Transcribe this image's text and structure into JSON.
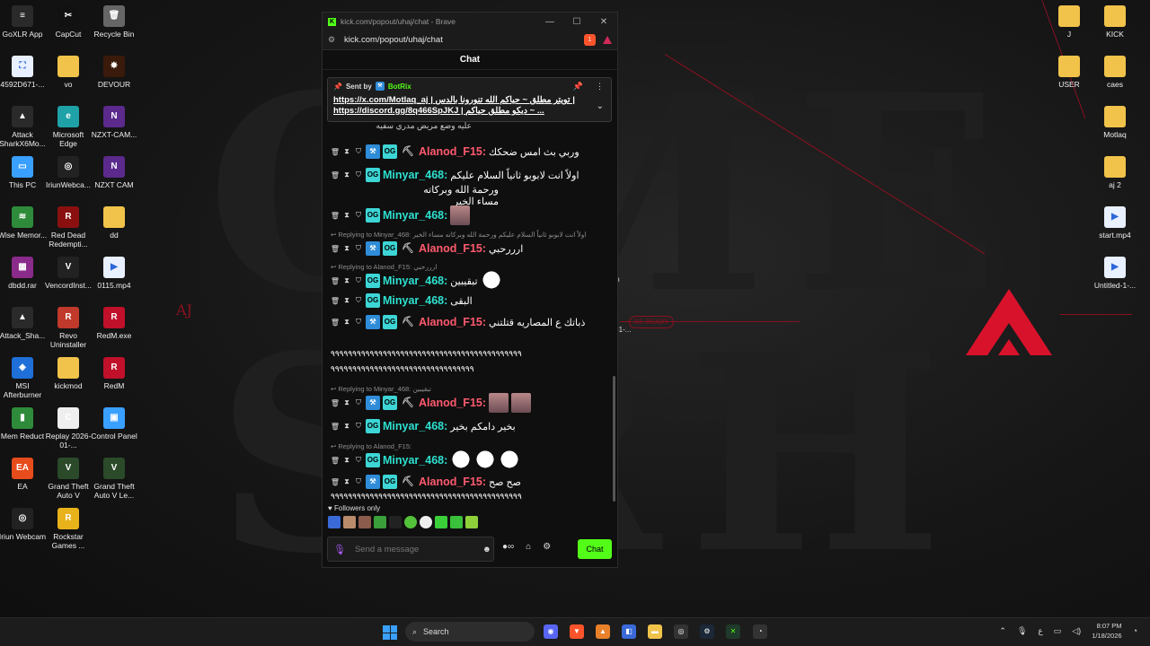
{
  "desktop": {
    "left_icons": [
      {
        "label": "GoXLR App",
        "color": "#2a2a2a",
        "glyph": "≡"
      },
      {
        "label": "CapCut",
        "color": "#111111",
        "glyph": "✂"
      },
      {
        "label": "Recycle Bin",
        "color": "#666666",
        "glyph": "🗑"
      },
      {
        "label": "4592D671-...",
        "color": "#e9f0ff",
        "glyph": "⛶"
      },
      {
        "label": "vo",
        "color": "#f1c34a",
        "glyph": ""
      },
      {
        "label": "DEVOUR",
        "color": "#3a1a0a",
        "glyph": "✸"
      },
      {
        "label": "Attack SharkX6Mo...",
        "color": "#2a2a2a",
        "glyph": "▲"
      },
      {
        "label": "Microsoft Edge",
        "color": "#1fa1a8",
        "glyph": "e"
      },
      {
        "label": "NZXT-CAM...",
        "color": "#5b2a8c",
        "glyph": "N"
      },
      {
        "label": "This PC",
        "color": "#3aa0ff",
        "glyph": "▭"
      },
      {
        "label": "IriunWebca...",
        "color": "#222222",
        "glyph": "◎"
      },
      {
        "label": "NZXT CAM",
        "color": "#5b2a8c",
        "glyph": "N"
      },
      {
        "label": "Wise Memor...",
        "color": "#2e8b3a",
        "glyph": "≋"
      },
      {
        "label": "Red Dead Redempti...",
        "color": "#8a1010",
        "glyph": "R"
      },
      {
        "label": "dd",
        "color": "#f1c34a",
        "glyph": ""
      },
      {
        "label": "dbdd.rar",
        "color": "#8a2a8a",
        "glyph": "▦"
      },
      {
        "label": "VencordInst...",
        "color": "#222222",
        "glyph": "V"
      },
      {
        "label": "0115.mp4",
        "color": "#e9f0ff",
        "glyph": "▶"
      },
      {
        "label": "Attack_Sha...",
        "color": "#2a2a2a",
        "glyph": "▲"
      },
      {
        "label": "Revo Uninstaller",
        "color": "#c0392b",
        "glyph": "R"
      },
      {
        "label": "RedM.exe",
        "color": "#c0102a",
        "glyph": "R"
      },
      {
        "label": "MSI Afterburner",
        "color": "#1f6fd8",
        "glyph": "◈"
      },
      {
        "label": "kickmod",
        "color": "#f1c34a",
        "glyph": ""
      },
      {
        "label": "RedM",
        "color": "#c0102a",
        "glyph": "R"
      },
      {
        "label": "Mem Reduct",
        "color": "#2e8b3a",
        "glyph": "▮"
      },
      {
        "label": "Replay 2026-01-...",
        "color": "#eeeeee",
        "glyph": "C"
      },
      {
        "label": "Control Panel",
        "color": "#3aa0ff",
        "glyph": "▣"
      },
      {
        "label": "EA",
        "color": "#e74c1c",
        "glyph": "EA"
      },
      {
        "label": "Grand Theft Auto V",
        "color": "#2a4a2a",
        "glyph": "V"
      },
      {
        "label": "Grand Theft Auto V Le...",
        "color": "#2a4a2a",
        "glyph": "V"
      },
      {
        "label": "Iriun Webcam",
        "color": "#222222",
        "glyph": "◎"
      },
      {
        "label": "Rockstar Games ...",
        "color": "#e8b21b",
        "glyph": "R"
      }
    ],
    "right_icons": [
      {
        "label": "J",
        "color": "#f1c34a",
        "glyph": ""
      },
      {
        "label": "KICK",
        "color": "#f1c34a",
        "glyph": ""
      },
      {
        "label": "USER",
        "color": "#f1c34a",
        "glyph": ""
      },
      {
        "label": "caes",
        "color": "#f1c34a",
        "glyph": ""
      },
      {
        "label": "Motlaq",
        "color": "#f1c34a",
        "glyph": ""
      },
      {
        "label": "aj 2",
        "color": "#f1c34a",
        "glyph": ""
      },
      {
        "label": "start.mp4",
        "color": "#e9f0ff",
        "glyph": "▶"
      },
      {
        "label": "Untitled-1-...",
        "color": "#e9f0ff",
        "glyph": "▶"
      }
    ],
    "partial_labels": {
      "m": "m",
      "one": "-1-..."
    },
    "wallpaper_tag_aj": "AJ",
    "wallpaper_tag_beready": "BE READY"
  },
  "browser": {
    "window_title": "kick.com/popout/uhaj/chat - Brave",
    "url": "kick.com/popout/uhaj/chat",
    "shield_count": "1"
  },
  "chat": {
    "header": "Chat",
    "pinned": {
      "sent_by_label": "Sent by",
      "sender": "BotRix",
      "line1": "https://x.com/Motlaq_aj | تويتر مطلق ~ حياكم الله تنورونا بالدس |",
      "line2": "https://discord.gg/8q466SpJKJ | ديكو مطلق حياكم ~ ..."
    },
    "partial_top_text": "عليه وضع مريض مدري سفيه",
    "messages": [
      {
        "user": "Alanod_F15",
        "color": "red",
        "text": "وربي بث امس ضحكك",
        "reply": ""
      },
      {
        "user": "Minyar_468",
        "color": "green",
        "text": "اولاً انت لابوبو ثانياً السلام عليكم",
        "cont": "ورحمة الله وبركاته مساء الخير",
        "reply": ""
      },
      {
        "user": "Minyar_468",
        "color": "green",
        "text": "",
        "reply": ""
      },
      {
        "user": "Alanod_F15",
        "color": "red",
        "text": "ارررحبي",
        "reply": "Replying to Minyar_468: اولاً انت لابوبو ثانياً السلام عليكم ورحمة الله وبركاته مساء الخير"
      },
      {
        "user": "Minyar_468",
        "color": "green",
        "text": "تبقيبين",
        "reply": "Replying to Alanod_F15: ارررحبي"
      },
      {
        "user": "Minyar_468",
        "color": "green",
        "text": "البقى",
        "reply": ""
      },
      {
        "user": "Alanod_F15",
        "color": "red",
        "text": "ذباتك ع المصاريه قتلتني",
        "reply": ""
      },
      {
        "user": "Alanod_F15",
        "color": "red",
        "text": "",
        "reply": "Replying to Minyar_468: تبقيبين"
      },
      {
        "user": "Minyar_468",
        "color": "green",
        "text": "بخير دامكم بخير",
        "reply": ""
      },
      {
        "user": "Minyar_468",
        "color": "green",
        "text": "",
        "reply": "Replying to Alanod_F15:"
      },
      {
        "user": "Alanod_F15",
        "color": "red",
        "text": "صح صح",
        "reply": ""
      }
    ],
    "spam_line": "۹۹۹۹۹۹۹۹۹۹۹۹۹۹۹۹۹۹۹۹۹۹۹۹۹۹۹۹۹۹۹۹۹۹۹۹۹۹۹۹۹۹۹۹",
    "spam_line_2": "۹۹۹۹۹۹۹۹۹۹۹۹۹۹۹۹۹۹۹۹۹۹۹۹۹۹۹۹۹۹۹۹۹",
    "followers_only": "Followers only",
    "composer_placeholder": "Send a message",
    "send_label": "Chat"
  },
  "taskbar": {
    "search_label": "Search",
    "lang": "ع",
    "time": "8:07 PM",
    "date": "1/18/2026"
  }
}
